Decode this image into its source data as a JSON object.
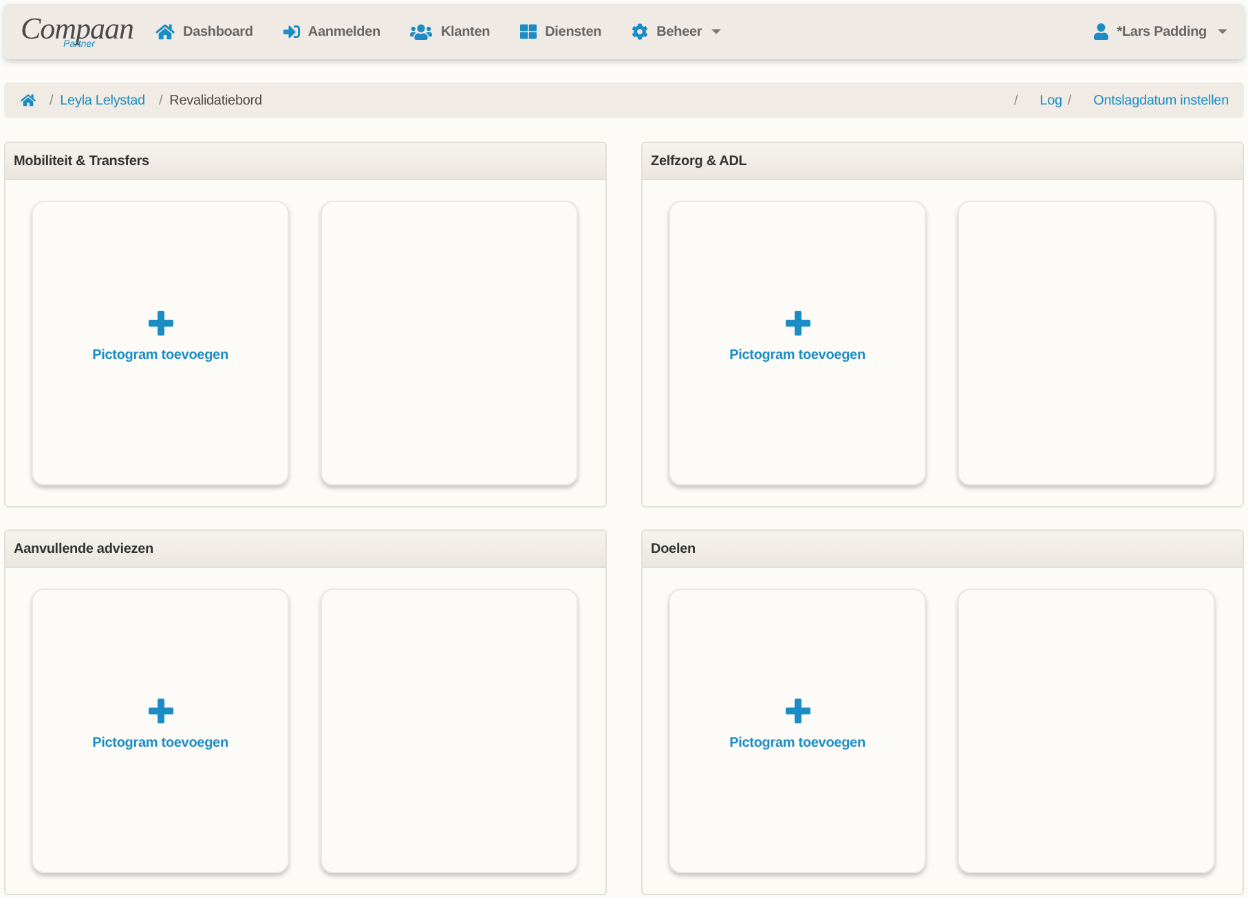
{
  "navbar": {
    "logo": {
      "wordmark": "Compaan",
      "tagline": "Partner"
    },
    "items": [
      {
        "label": "Dashboard",
        "has_menu": false
      },
      {
        "label": "Aanmelden",
        "has_menu": false
      },
      {
        "label": "Klanten",
        "has_menu": false
      },
      {
        "label": "Diensten",
        "has_menu": false
      },
      {
        "label": "Beheer",
        "has_menu": true
      }
    ],
    "user": {
      "label": "*Lars Padding",
      "has_menu": true
    }
  },
  "breadcrumb": {
    "trail": [
      {
        "kind": "home"
      },
      {
        "kind": "separator",
        "label": "/"
      },
      {
        "kind": "link",
        "label": "Leyla Lelystad"
      },
      {
        "kind": "separator",
        "label": "/"
      },
      {
        "kind": "current",
        "label": "Revalidatiebord"
      }
    ],
    "actions": [
      {
        "kind": "separator",
        "label": "/"
      },
      {
        "kind": "link",
        "label": "Log"
      },
      {
        "kind": "separator",
        "label": "/"
      },
      {
        "kind": "link",
        "label": "Ontslagdatum instellen"
      }
    ]
  },
  "panels": [
    {
      "title": "Mobiliteit & Transfers",
      "tiles": [
        {
          "kind": "add",
          "label": "Pictogram toevoegen"
        },
        {
          "kind": "empty"
        }
      ]
    },
    {
      "title": "Zelfzorg & ADL",
      "tiles": [
        {
          "kind": "add",
          "label": "Pictogram toevoegen"
        },
        {
          "kind": "empty"
        }
      ]
    },
    {
      "title": "Aanvullende adviezen",
      "tiles": [
        {
          "kind": "add",
          "label": "Pictogram toevoegen"
        },
        {
          "kind": "empty"
        }
      ]
    },
    {
      "title": "Doelen",
      "tiles": [
        {
          "kind": "add",
          "label": "Pictogram toevoegen"
        },
        {
          "kind": "empty"
        }
      ]
    }
  ]
}
